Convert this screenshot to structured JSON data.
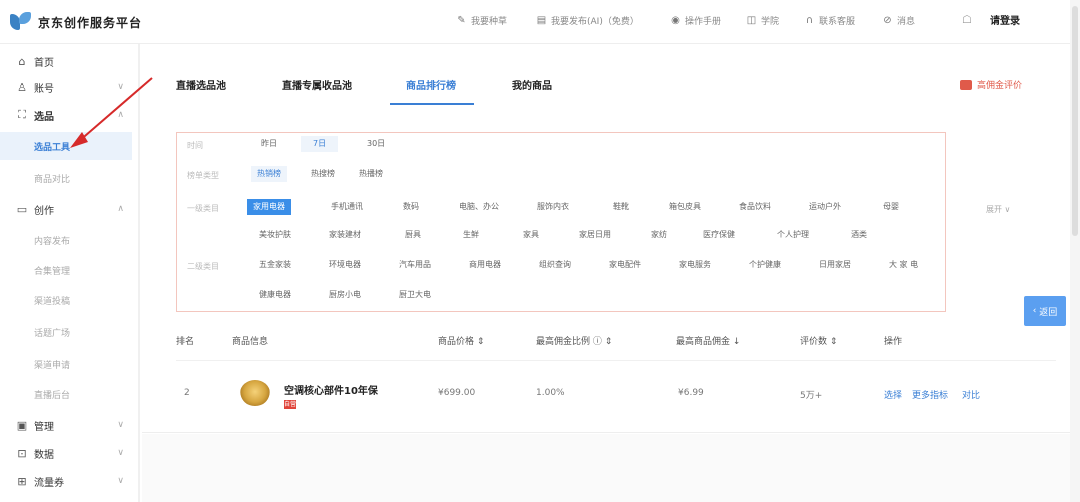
{
  "header": {
    "logo_text": "京东创作服务平台",
    "nav": [
      {
        "icon": "pen-icon",
        "label": "我要种草"
      },
      {
        "icon": "document-icon",
        "label": "我要发布(AI)（免费）"
      },
      {
        "icon": "location-icon",
        "label": "操作手册"
      },
      {
        "icon": "book-icon",
        "label": "学院"
      },
      {
        "icon": "headset-icon",
        "label": "联系客服"
      },
      {
        "icon": "message-icon",
        "label": "消息"
      }
    ],
    "login_label": "请登录"
  },
  "sidebar": {
    "items": [
      {
        "icon": "home-icon",
        "label": "首页"
      },
      {
        "icon": "user-icon",
        "label": "账号"
      },
      {
        "icon": "scan-icon",
        "label": "选品"
      },
      {
        "icon": "folder-icon",
        "label": "创作"
      },
      {
        "icon": "manage-icon",
        "label": "管理"
      },
      {
        "icon": "data-icon",
        "label": "数据"
      },
      {
        "icon": "flow-icon",
        "label": "流量券"
      }
    ],
    "sub_xuanpin": [
      "选品工具",
      "商品对比"
    ],
    "sub_chuangzuo": [
      "内容发布",
      "合集管理",
      "渠道投稿",
      "话题广场",
      "渠道申请",
      "直播后台"
    ]
  },
  "tabs": [
    "直播选品池",
    "直播专属收品池",
    "商品排行榜",
    "我的商品"
  ],
  "active_tab": 2,
  "review_label": "高佣金评价",
  "filter": {
    "time_label": "时间",
    "time_options": [
      "昨日",
      "7日",
      "30日"
    ],
    "rank_label": "榜单类型",
    "rank_options": [
      "热销榜",
      "热搜榜",
      "热播榜"
    ],
    "cat1_label": "一级类目",
    "cat1_options": [
      "家用电器",
      "手机通讯",
      "数码",
      "电脑、办公",
      "服饰内衣",
      "鞋靴",
      "箱包皮具",
      "食品饮料",
      "运动户外",
      "母婴",
      "美妆护肤",
      "家装建材",
      "厨具",
      "生鲜",
      "家具",
      "家居日用",
      "家纺",
      "医疗保健",
      "个人护理",
      "酒类"
    ],
    "cat2_label": "二级类目",
    "cat2_options": [
      "五金家装",
      "环境电器",
      "汽车用品",
      "商用电器",
      "组织查询",
      "家电配件",
      "家电服务",
      "个护健康",
      "日用家居",
      "大 家 电",
      "健康电器",
      "厨房小电",
      "厨卫大电"
    ],
    "expand_label": "展开"
  },
  "back_label": "返回",
  "table": {
    "headers": [
      "排名",
      "商品信息",
      "商品价格",
      "最高佣金比例",
      "最高商品佣金",
      "评价数",
      "操作"
    ],
    "rows": [
      {
        "rank": "2",
        "name": "空调核心部件10年保",
        "badge": "自营",
        "price": "¥699.00",
        "ratio": "1.00%",
        "commission": "¥6.99",
        "reviews": "5万+",
        "actions": [
          "选择",
          "更多指标",
          "对比"
        ]
      }
    ]
  }
}
